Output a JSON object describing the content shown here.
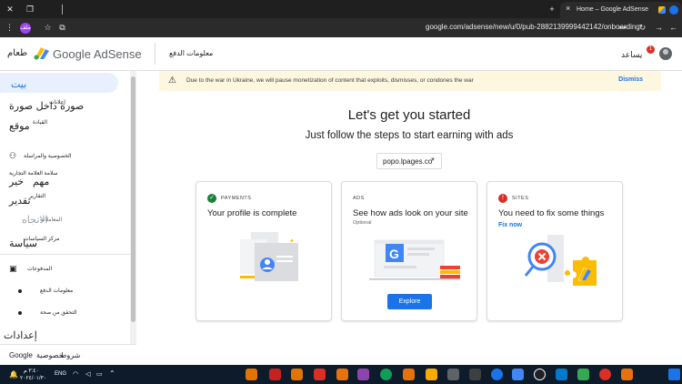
{
  "browser": {
    "tab_title": "Home – Google AdSense",
    "url": "google.com/adsense/new/u/0/pub-2882139999442142/onboarding",
    "profile_initial": "ملف",
    "new_tab_symbol": "+",
    "close_symbol": "×"
  },
  "header": {
    "logo_text": "طعام",
    "logo_overlay": "Google",
    "product": "Google AdSense",
    "page_name": "معلومات الدفع",
    "help_label": "يساعد",
    "notification_count": "1"
  },
  "sidebar": {
    "home": "بيت",
    "items": [
      {
        "label": "صورة داخل صورة"
      },
      {
        "label": "إعلانات"
      },
      {
        "label": "موقع"
      },
      {
        "label": "القيادة"
      },
      {
        "label": "الخصوصية والمراسلة"
      },
      {
        "label": "سلامة العلامة التجارية"
      },
      {
        "label": "خير"
      },
      {
        "label": "مهم"
      },
      {
        "label": "التقارير"
      },
      {
        "label": "تقدير"
      },
      {
        "label": "الاتجاه"
      },
      {
        "label": "المعاملات"
      },
      {
        "label": "مركز السياسات"
      },
      {
        "label": "سياسة"
      },
      {
        "label": "المدفوعات"
      },
      {
        "label": "معلومات الدفع"
      },
      {
        "label": "التحقق من صحة"
      },
      {
        "label": "إعدادات"
      }
    ],
    "footer": [
      "Google",
      "خصوصية",
      "شروط"
    ]
  },
  "banner": {
    "text": "Due to the war in Ukraine, we will pause monetization of content that exploits, dismisses, or condones the war",
    "action": "Dismiss"
  },
  "hero": {
    "title": "Let's get you started",
    "subtitle": "Just follow the steps to start earning with ads"
  },
  "site_select": {
    "value": "popo.lpages.co"
  },
  "cards": {
    "payments": {
      "eyebrow": "PAYMENTS",
      "heading": "Your profile is complete",
      "status_color": "#188038"
    },
    "ads": {
      "eyebrow": "ADS",
      "heading": "See how ads look on your site",
      "meta": "Optional",
      "button": "Explore"
    },
    "sites": {
      "eyebrow": "SITES",
      "heading": "You need to fix some things",
      "link": "Fix now",
      "status_color": "#d93025"
    }
  },
  "taskbar": {
    "lang": "ENG",
    "time": "٣:٤٠ م",
    "date": "٢٠٢٤/٠١/٣٠"
  },
  "colors": {
    "accent": "#1a73e8",
    "banner_bg": "#fef7e0",
    "success": "#188038",
    "error": "#d93025"
  }
}
